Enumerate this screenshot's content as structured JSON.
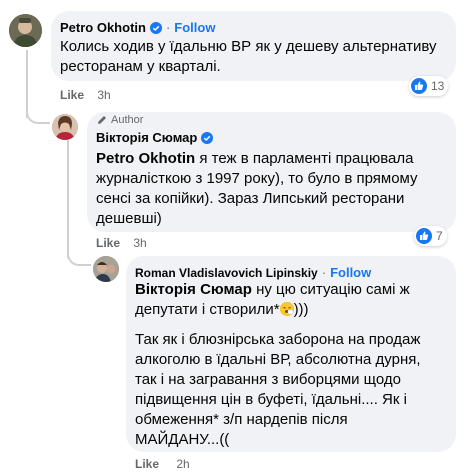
{
  "comment1": {
    "author": "Petro Okhotin",
    "separator": "·",
    "follow": "Follow",
    "text_line1": "Колись ходив у їдальню ВР як у дешеву альтернативу",
    "text_line2": "ресторанам у кварталі.",
    "reaction_count": "13",
    "like": "Like",
    "time": "3h"
  },
  "comment2": {
    "badge": "Author",
    "author": "Вікторія Сюмар",
    "mention": "Petro Okhotin",
    "text_line1_rest": " я теж в парламенті працювала",
    "text_line2": "журналісткою з 1997 року), то було в прямому",
    "text_line3": "сенсі за копійки). Зараз Липський ресторани",
    "text_line4": "дешевші)",
    "reaction_count": "7",
    "like": "Like",
    "time": "3h"
  },
  "comment3": {
    "author": "Roman Vladislavovich Lipinskiy",
    "separator": "·",
    "follow": "Follow",
    "mention": "Вікторія Сюмар",
    "text_line1_rest": " ну цю ситуацію самі ж",
    "text_line2_pre": "депутати і створили*",
    "text_line2_post": ")))",
    "para2_line1": "Так як і блюзнірська заборона на продаж",
    "para2_line2": "алкоголю в їдальні ВР, абсолютна дурня,",
    "para2_line3": "так і на загравання з виборцями щодо",
    "para2_line4": "підвищення цін в буфеті, їдальні.... Як і",
    "para2_line5": "обмеження* з/п нардепів після",
    "para2_line6": "МАЙДАНУ...((",
    "like": "Like",
    "time": "2h"
  },
  "colors": {
    "bubble": "#f0f2f5",
    "link": "#1877f2",
    "muted": "#65676b",
    "thread_line": "#ced0d4"
  }
}
